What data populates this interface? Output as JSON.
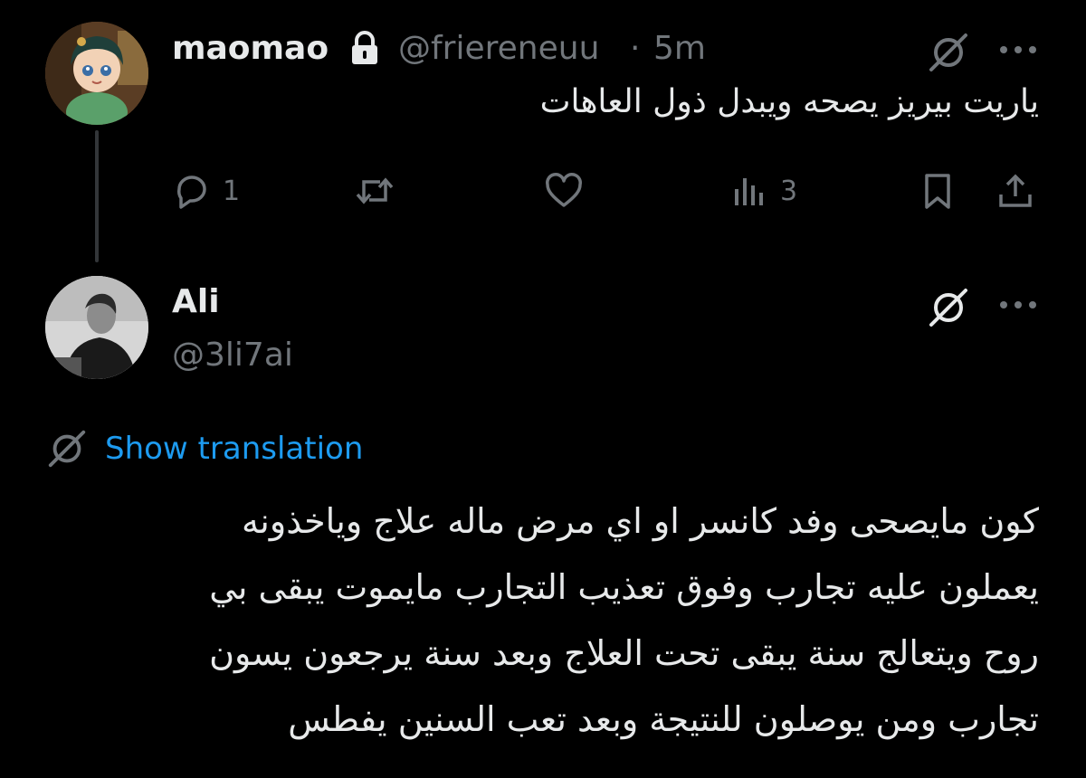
{
  "tweet1": {
    "display_name": "maomao",
    "handle": "@friereneuu",
    "separator": "·",
    "time": "5m",
    "text": "ياريت بيريز يصحه ويبدل ذول العاهات",
    "counts": {
      "replies": "1",
      "views": "3"
    }
  },
  "tweet2": {
    "display_name": "Ali",
    "handle": "@3li7ai",
    "show_translation": "Show translation",
    "lines": [
      "كون مايصحى وفد كانسر او اي مرض ماله علاج وياخذونه",
      "يعملون عليه تجارب وفوق تعذيب التجارب مايموت يبقى بي",
      "روح ويتعالج سنة يبقى تحت العلاج وبعد سنة يرجعون يسون",
      "تجارب ومن يوصلون للنتيجة وبعد تعب السنين يفطس"
    ]
  },
  "colors": {
    "background": "#000000",
    "text": "#e7e9ea",
    "muted": "#71767b",
    "link": "#1d9bf0",
    "thread_line": "#333639"
  },
  "icons": [
    "lock-icon",
    "grok-icon",
    "more-icon",
    "reply-icon",
    "retweet-icon",
    "like-icon",
    "views-icon",
    "bookmark-icon",
    "share-icon",
    "translate-icon"
  ]
}
